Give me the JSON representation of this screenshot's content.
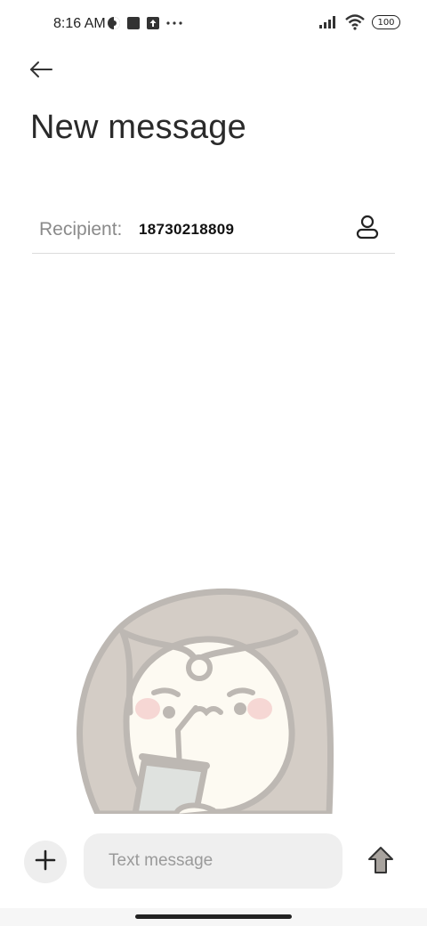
{
  "status_bar": {
    "time": "8:16 AM",
    "battery": "100",
    "left_icons": [
      "vpn-icon",
      "square-notification-icon",
      "upload-notification-icon",
      "more-notifications-icon"
    ],
    "right_icons": [
      "signal-icon",
      "wifi-icon",
      "battery-icon"
    ]
  },
  "header": {
    "back_icon": "arrow-left-icon",
    "title": "New message"
  },
  "recipient": {
    "label": "Recipient:",
    "value": "18730218809",
    "contact_icon": "person-icon"
  },
  "composer": {
    "add_icon": "plus-icon",
    "placeholder": "Text message",
    "value": "",
    "send_icon": "arrow-up-icon"
  },
  "colors": {
    "background": "#ffffff",
    "input_bg": "#efefef",
    "muted_text": "#8a8a8a",
    "illustration_hair": "#d3ccc4",
    "illustration_outline": "#bdb8b3"
  }
}
